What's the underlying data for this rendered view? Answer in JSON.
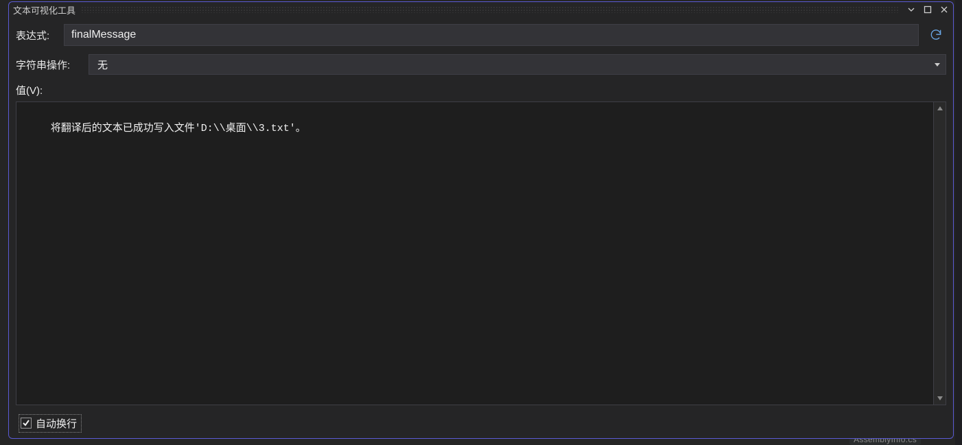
{
  "window": {
    "title": "文本可视化工具"
  },
  "expression": {
    "label": "表达式:",
    "value": "finalMessage"
  },
  "string_ops": {
    "label": "字符串操作:",
    "selected": "无"
  },
  "value_section": {
    "label": "值(V):",
    "content_prefix": "将翻译后的文本已成功写入文件",
    "content_path": "'D:\\\\桌面\\\\3.txt'",
    "content_suffix": "。"
  },
  "footer": {
    "wrap_label": "自动换行",
    "wrap_checked": true
  },
  "background": {
    "file_hint": "AssemblyInfo.cs"
  }
}
